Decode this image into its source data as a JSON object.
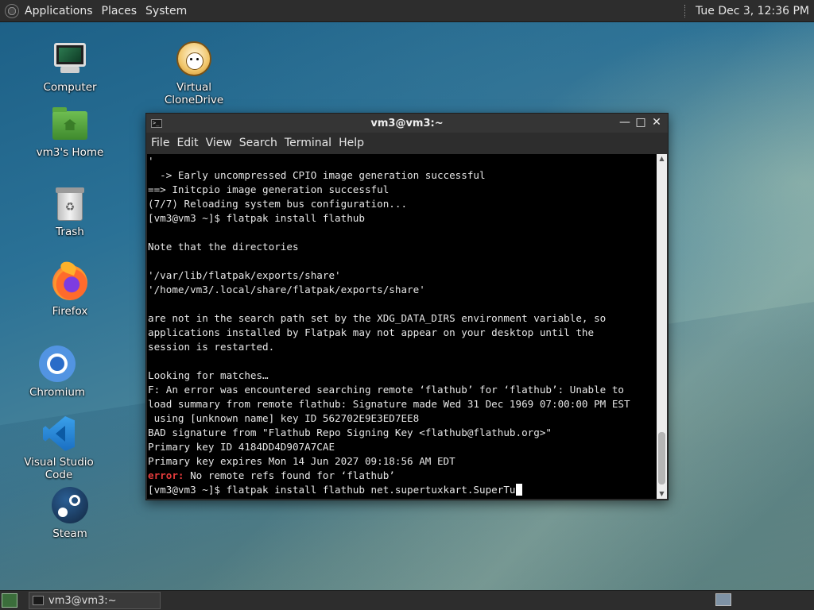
{
  "top_panel": {
    "menus": [
      "Applications",
      "Places",
      "System"
    ],
    "clock": "Tue Dec 3, 12:36 PM"
  },
  "desktop_icons": [
    {
      "label": "Computer",
      "icon": "computer-icon"
    },
    {
      "label": "Virtual CloneDrive",
      "icon": "clonedrive-icon"
    },
    {
      "label": "vm3's Home",
      "icon": "home-folder-icon"
    },
    {
      "label": "Trash",
      "icon": "trash-icon"
    },
    {
      "label": "Firefox",
      "icon": "firefox-icon"
    },
    {
      "label": "Chromium",
      "icon": "chromium-icon"
    },
    {
      "label": "Visual Studio Code",
      "icon": "vscode-icon"
    },
    {
      "label": "Steam",
      "icon": "steam-icon"
    }
  ],
  "terminal": {
    "title": "vm3@vm3:~",
    "menu": [
      "File",
      "Edit",
      "View",
      "Search",
      "Terminal",
      "Help"
    ],
    "lines": [
      {
        "text": "'"
      },
      {
        "text": "  -> Early uncompressed CPIO image generation successful"
      },
      {
        "text": "==> Initcpio image generation successful"
      },
      {
        "text": "(7/7) Reloading system bus configuration..."
      },
      {
        "text": "[vm3@vm3 ~]$ flatpak install flathub"
      },
      {
        "text": ""
      },
      {
        "text": "Note that the directories"
      },
      {
        "text": ""
      },
      {
        "text": "'/var/lib/flatpak/exports/share'"
      },
      {
        "text": "'/home/vm3/.local/share/flatpak/exports/share'"
      },
      {
        "text": ""
      },
      {
        "text": "are not in the search path set by the XDG_DATA_DIRS environment variable, so"
      },
      {
        "text": "applications installed by Flatpak may not appear on your desktop until the"
      },
      {
        "text": "session is restarted."
      },
      {
        "text": ""
      },
      {
        "text": "Looking for matches…"
      },
      {
        "text": "F: An error was encountered searching remote ‘flathub’ for ‘flathub’: Unable to"
      },
      {
        "text": "load summary from remote flathub: Signature made Wed 31 Dec 1969 07:00:00 PM EST"
      },
      {
        "text": " using [unknown name] key ID 562702E9E3ED7EE8"
      },
      {
        "text": "BAD signature from \"Flathub Repo Signing Key <flathub@flathub.org>\""
      },
      {
        "text": "Primary key ID 4184DD4D907A7CAE"
      },
      {
        "text": "Primary key expires Mon 14 Jun 2027 09:18:56 AM EDT"
      },
      {
        "prefix": "error:",
        "text": " No remote refs found for ‘flathub’"
      }
    ],
    "prompt": "[vm3@vm3 ~]$ flatpak install flathub net.supertuxkart.SuperTu"
  },
  "taskbar": {
    "task_label": "vm3@vm3:~"
  },
  "colors": {
    "panel": "#2d2d2d",
    "error": "#e33b3b"
  }
}
